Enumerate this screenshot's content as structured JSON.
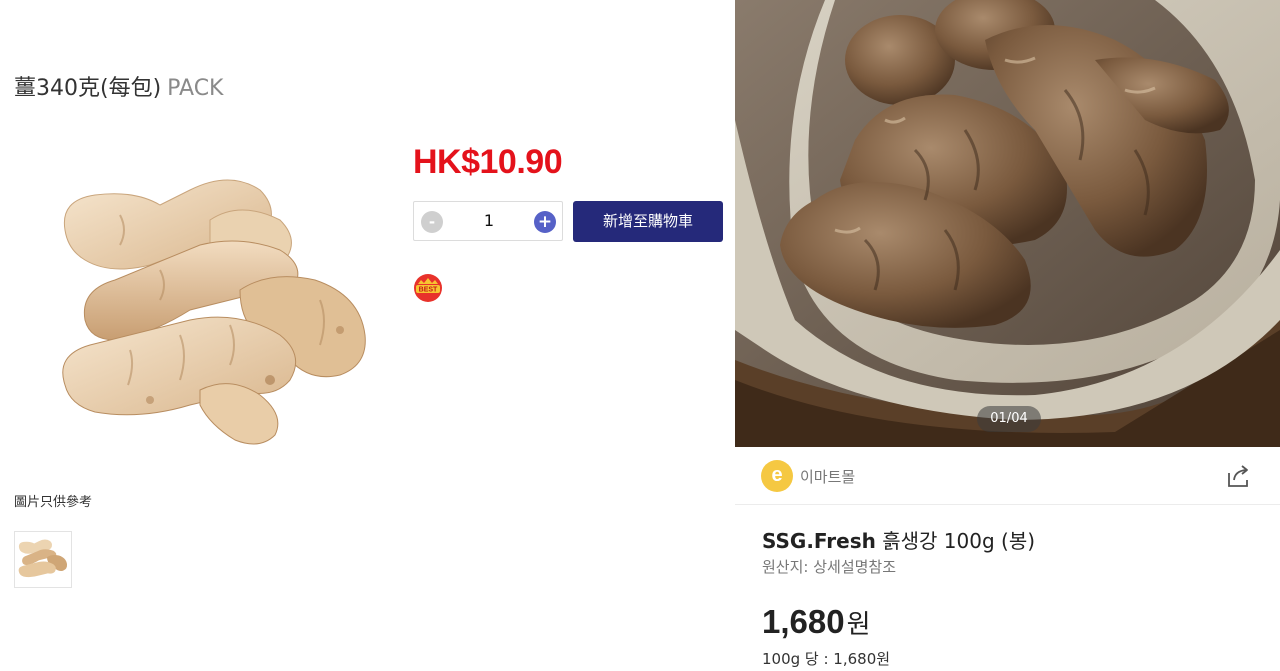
{
  "left": {
    "title": "薑340克(每包)",
    "title_unit": "PACK",
    "price": "HK$10.90",
    "quantity": {
      "minus": "-",
      "value": "1",
      "plus": "+"
    },
    "add_to_cart": "新增至購物車",
    "best_badge": "BEST",
    "image_caption": "圖片只供參考"
  },
  "right": {
    "pager": "01/04",
    "seller": {
      "logo_letter": "e",
      "name": "이마트몰"
    },
    "product": {
      "brand": "SSG.Fresh",
      "name": "흙생강 100g (봉)",
      "origin": "원산지: 상세설명참조",
      "price_value": "1,680",
      "price_currency": "원",
      "unit_price": "100g 당 : 1,680원"
    }
  },
  "colors": {
    "price_red": "#e4121b",
    "cart_button": "#25297a",
    "plus_button": "#5661c7",
    "seller_logo": "#f5c842"
  },
  "icons": {
    "share": "share-icon",
    "best": "best-badge-icon"
  }
}
